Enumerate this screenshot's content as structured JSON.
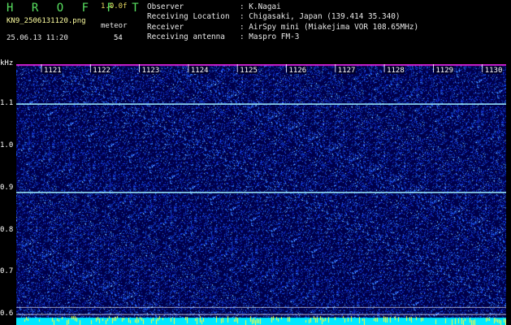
{
  "header": {
    "brand": "H R O F F T",
    "version": "1.0.0f",
    "filename": "KN9_2506131120.png",
    "meteor_label": "meteor",
    "datetime": "25.06.13 11:20",
    "meteor_count": "54",
    "info": [
      {
        "key": "Observer",
        "value": ": K.Nagai"
      },
      {
        "key": "Receiving Location",
        "value": ": Chigasaki, Japan (139.414 35.340)"
      },
      {
        "key": "Receiver",
        "value": ": AirSpy mini (Miakejima VOR 108.65MHz)"
      },
      {
        "key": "Receiving antenna",
        "value": ": Maspro FM-3"
      }
    ]
  },
  "spectrogram": {
    "y_unit": "kHz",
    "y_ticks": [
      "1.1",
      "1.0",
      "0.9",
      "0.8",
      "0.7",
      "0.6"
    ],
    "y_tick_values": [
      1.1,
      1.0,
      0.9,
      0.8,
      0.7,
      0.6
    ],
    "y_range": [
      0.575,
      1.195
    ],
    "time_labels": [
      "1121",
      "1122",
      "1123",
      "1124",
      "1125",
      "1126",
      "1127",
      "1128",
      "1129",
      "1130"
    ],
    "carrier_lines_khz": [
      1.1,
      0.89
    ],
    "reference_lines_khz": [
      0.617,
      0.6
    ],
    "colors": {
      "background": "#00004a",
      "noise": "#1a3cff",
      "carrier": "#9ff0ff",
      "bottom_band": "#00e8ff",
      "magenta": "#d020d0",
      "grid": "#ffffff"
    }
  }
}
